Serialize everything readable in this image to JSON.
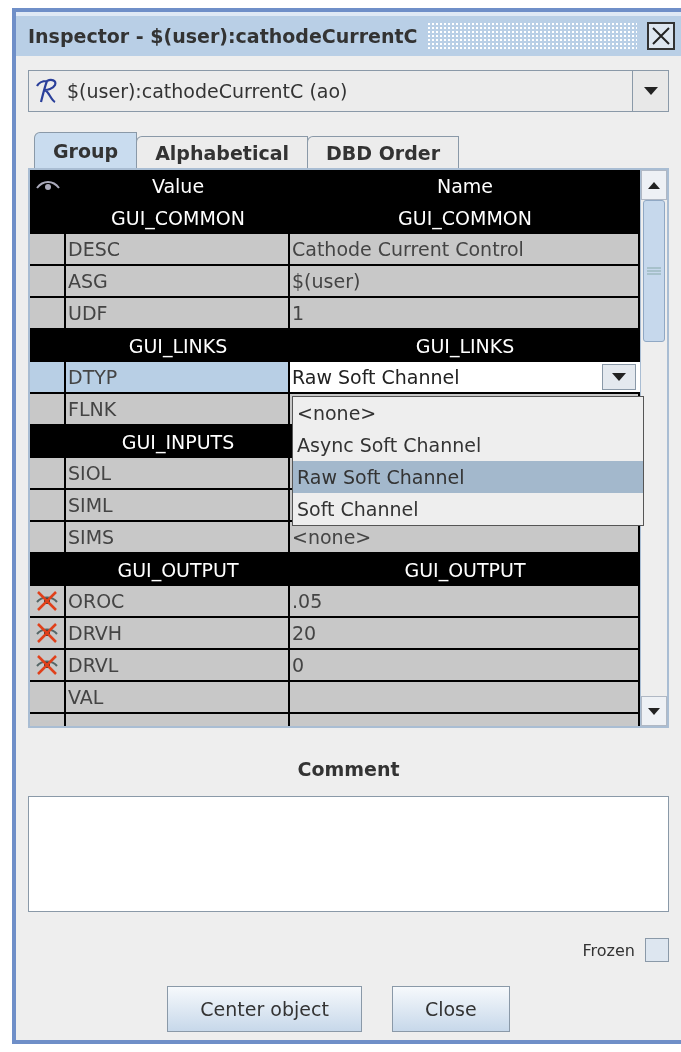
{
  "window": {
    "title": "Inspector - $(user):cathodeCurrentC"
  },
  "object_selector": {
    "value": "$(user):cathodeCurrentC (ao)"
  },
  "tabs": [
    {
      "label": "Group",
      "selected": true
    },
    {
      "label": "Alphabetical",
      "selected": false
    },
    {
      "label": "DBD Order",
      "selected": false
    }
  ],
  "table": {
    "columns": [
      "Value",
      "Name"
    ],
    "rows": [
      {
        "kind": "group",
        "value": "GUI_COMMON",
        "name": "GUI_COMMON"
      },
      {
        "kind": "field",
        "field": "DESC",
        "value": "Cathode Current Control",
        "flagged": false,
        "selected": false
      },
      {
        "kind": "field",
        "field": "ASG",
        "value": "$(user)",
        "flagged": false,
        "selected": false
      },
      {
        "kind": "field",
        "field": "UDF",
        "value": "1",
        "flagged": false,
        "selected": false
      },
      {
        "kind": "group",
        "value": "GUI_LINKS",
        "name": "GUI_LINKS"
      },
      {
        "kind": "field",
        "field": "DTYP",
        "value": "Raw Soft Channel",
        "flagged": false,
        "selected": true,
        "editing": true
      },
      {
        "kind": "field",
        "field": "FLNK",
        "flagged": false,
        "selected": false
      },
      {
        "kind": "group",
        "value": "GUI_INPUTS"
      },
      {
        "kind": "field",
        "field": "SIOL",
        "flagged": false,
        "selected": false
      },
      {
        "kind": "field",
        "field": "SIML",
        "flagged": false,
        "selected": false
      },
      {
        "kind": "field",
        "field": "SIMS",
        "value": "<none>",
        "flagged": false,
        "selected": false
      },
      {
        "kind": "group",
        "value": "GUI_OUTPUT",
        "name": "GUI_OUTPUT"
      },
      {
        "kind": "field",
        "field": "OROC",
        "value": ".05",
        "flagged": true,
        "selected": false
      },
      {
        "kind": "field",
        "field": "DRVH",
        "value": "20",
        "flagged": true,
        "selected": false
      },
      {
        "kind": "field",
        "field": "DRVL",
        "value": "0",
        "flagged": true,
        "selected": false
      },
      {
        "kind": "field",
        "field": "VAL",
        "value": "",
        "flagged": false,
        "selected": false
      }
    ],
    "dropdown_options": [
      {
        "label": "<none>",
        "selected": false
      },
      {
        "label": "Async Soft Channel",
        "selected": false
      },
      {
        "label": "Raw Soft Channel",
        "selected": true
      },
      {
        "label": "Soft Channel",
        "selected": false
      }
    ]
  },
  "comment": {
    "label": "Comment"
  },
  "frozen": {
    "label": "Frozen",
    "checked": false
  },
  "buttons": [
    "Center object",
    "Close"
  ]
}
